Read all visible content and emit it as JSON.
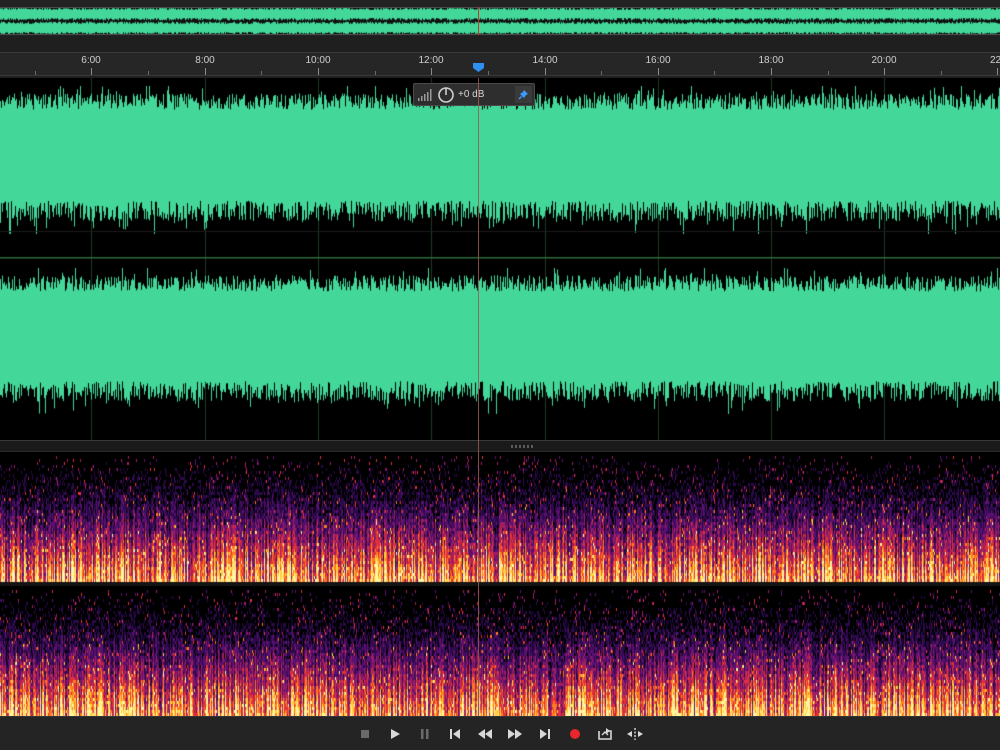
{
  "overview": {
    "wave_color": "#43d89a"
  },
  "timeline": {
    "labels": [
      "6:00",
      "8:00",
      "10:00",
      "12:00",
      "14:00",
      "16:00",
      "18:00",
      "20:00",
      "22:"
    ],
    "playhead_icon": "current-time-indicator-icon"
  },
  "hud": {
    "volume_icon": "volume-bars-icon",
    "knob_icon": "volume-knob-icon",
    "gain_label": "+0 dB",
    "pin_icon": "pin-icon"
  },
  "waveform": {
    "channels": [
      "left-channel",
      "right-channel"
    ],
    "wave_color": "#43d89a",
    "background": "#000000"
  },
  "spectral": {
    "channels": [
      "left-channel",
      "right-channel"
    ],
    "palette": [
      "#000000",
      "#2a0a4a",
      "#5a1070",
      "#a01e60",
      "#e0303a",
      "#ff7a20",
      "#ffd040",
      "#fff6a0"
    ]
  },
  "transport": {
    "buttons": [
      {
        "name": "stop-button",
        "icon": "stop-icon"
      },
      {
        "name": "play-button",
        "icon": "play-icon"
      },
      {
        "name": "pause-button",
        "icon": "pause-icon"
      },
      {
        "name": "go-to-start-button",
        "icon": "skip-to-start-icon"
      },
      {
        "name": "rewind-button",
        "icon": "rewind-icon"
      },
      {
        "name": "fast-forward-button",
        "icon": "fast-forward-icon"
      },
      {
        "name": "go-to-end-button",
        "icon": "skip-to-end-icon"
      },
      {
        "name": "record-button",
        "icon": "record-icon"
      },
      {
        "name": "loop-playback-button",
        "icon": "loop-icon"
      },
      {
        "name": "skip-selection-button",
        "icon": "skip-selection-icon"
      }
    ],
    "record_color": "#e8262c"
  }
}
